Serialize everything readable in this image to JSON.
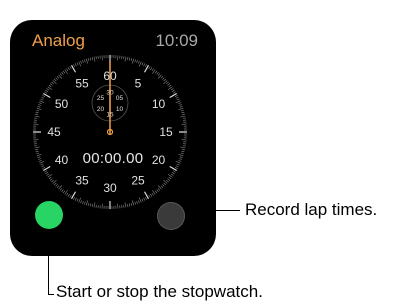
{
  "header": {
    "mode_title": "Analog",
    "clock_time": "10:09"
  },
  "stopwatch": {
    "elapsed": "00:00.00",
    "outer_dial_numbers": [
      "60",
      "5",
      "10",
      "15",
      "20",
      "25",
      "30",
      "35",
      "40",
      "45",
      "50",
      "55"
    ],
    "inner_dial_numbers": [
      "30",
      "05",
      "10",
      "15",
      "20",
      "25"
    ],
    "hand_color": "#f0a04b"
  },
  "buttons": {
    "start_stop_color": "#28d564",
    "lap_color": "#3a3a3a"
  },
  "callouts": {
    "lap": "Record lap times.",
    "start_stop": "Start or stop the stopwatch."
  }
}
